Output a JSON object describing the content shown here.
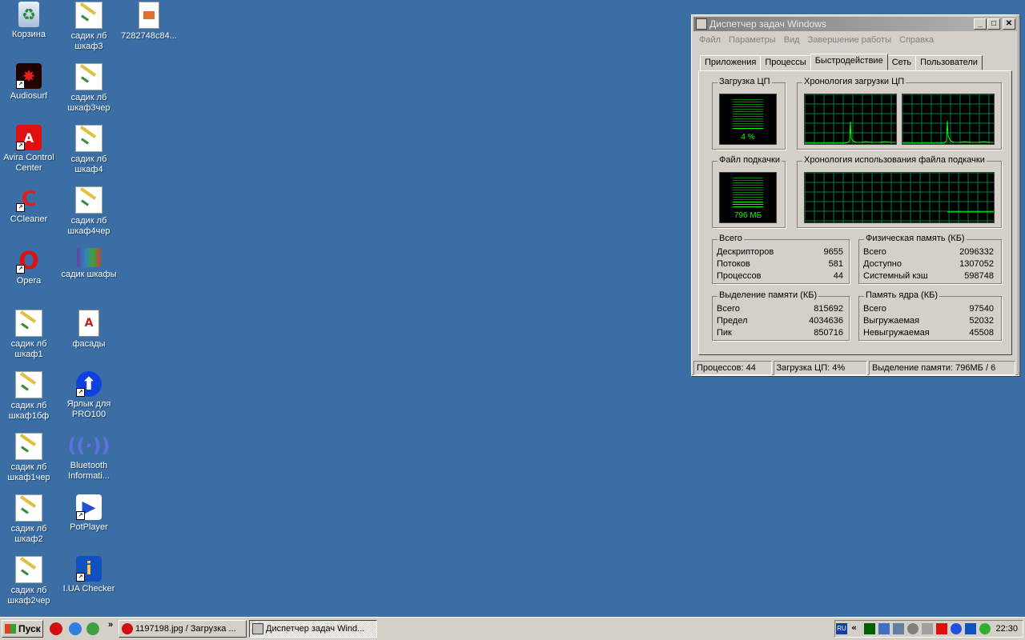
{
  "desktop": {
    "icons": [
      {
        "label": "Корзина"
      },
      {
        "label": "садик лб шкаф3"
      },
      {
        "label": "7282748c84..."
      },
      {
        "label": "Audiosurf"
      },
      {
        "label": "садик лб шкаф3чер"
      },
      {
        "label": "Avira Control Center"
      },
      {
        "label": "садик лб шкаф4"
      },
      {
        "label": "CCleaner"
      },
      {
        "label": "садик лб шкаф4чер"
      },
      {
        "label": "Opera"
      },
      {
        "label": "садик шкафы"
      },
      {
        "label": "садик лб шкаф1"
      },
      {
        "label": "фасады"
      },
      {
        "label": "садик лб шкаф1бф"
      },
      {
        "label": "Ярлык для PRO100"
      },
      {
        "label": "садик лб шкаф1чер"
      },
      {
        "label": "Bluetooth Informati..."
      },
      {
        "label": "садик лб шкаф2"
      },
      {
        "label": "PotPlayer"
      },
      {
        "label": "садик лб шкаф2чер"
      },
      {
        "label": "I.UA Checker"
      }
    ]
  },
  "window": {
    "title": "Диспетчер задач Windows",
    "buttons": {
      "minimize": "_",
      "maximize": "□",
      "close": "✕"
    },
    "menu": [
      "Файл",
      "Параметры",
      "Вид",
      "Завершение работы",
      "Справка"
    ],
    "tabs": [
      "Приложения",
      "Процессы",
      "Быстродействие",
      "Сеть",
      "Пользователи"
    ],
    "active_tab": "Быстродействие",
    "cpu_group": {
      "title": "Загрузка ЦП",
      "value": "4 %",
      "level": 0.04
    },
    "cpu_history": {
      "title": "Хронология загрузки ЦП"
    },
    "page_group": {
      "title": "Файл подкачки",
      "value": "796 МБ",
      "level": 0.2
    },
    "page_history": {
      "title": "Хронология использования файла подкачки"
    },
    "totals": {
      "title": "Всего",
      "rows": [
        [
          "Дескрипторов",
          "9655"
        ],
        [
          "Потоков",
          "581"
        ],
        [
          "Процессов",
          "44"
        ]
      ]
    },
    "physical": {
      "title": "Физическая память (КБ)",
      "rows": [
        [
          "Всего",
          "2096332"
        ],
        [
          "Доступно",
          "1307052"
        ],
        [
          "Системный кэш",
          "598748"
        ]
      ]
    },
    "commit": {
      "title": "Выделение памяти (КБ)",
      "rows": [
        [
          "Всего",
          "815692"
        ],
        [
          "Предел",
          "4034636"
        ],
        [
          "Пик",
          "850716"
        ]
      ]
    },
    "kernel": {
      "title": "Память ядра (КБ)",
      "rows": [
        [
          "Всего",
          "97540"
        ],
        [
          "Выгружаемая",
          "52032"
        ],
        [
          "Невыгружаемая",
          "45508"
        ]
      ]
    },
    "status": [
      "Процессов: 44",
      "Загрузка ЦП: 4%",
      "Выделение памяти: 796МБ / 6"
    ]
  },
  "taskbar": {
    "start_label": "Пуск",
    "quicklaunch_more": "»",
    "tasks": [
      {
        "label": "1197198.jpg / Загрузка ...",
        "active": false
      },
      {
        "label": "Диспетчер задач Wind...",
        "active": true
      }
    ],
    "tray": {
      "lang": "RU",
      "more": "«",
      "clock": "22:30"
    }
  },
  "colors": {
    "desktop": "#3a6ea5",
    "graph_line": "#00ff00",
    "graph_grid": "#008040"
  }
}
